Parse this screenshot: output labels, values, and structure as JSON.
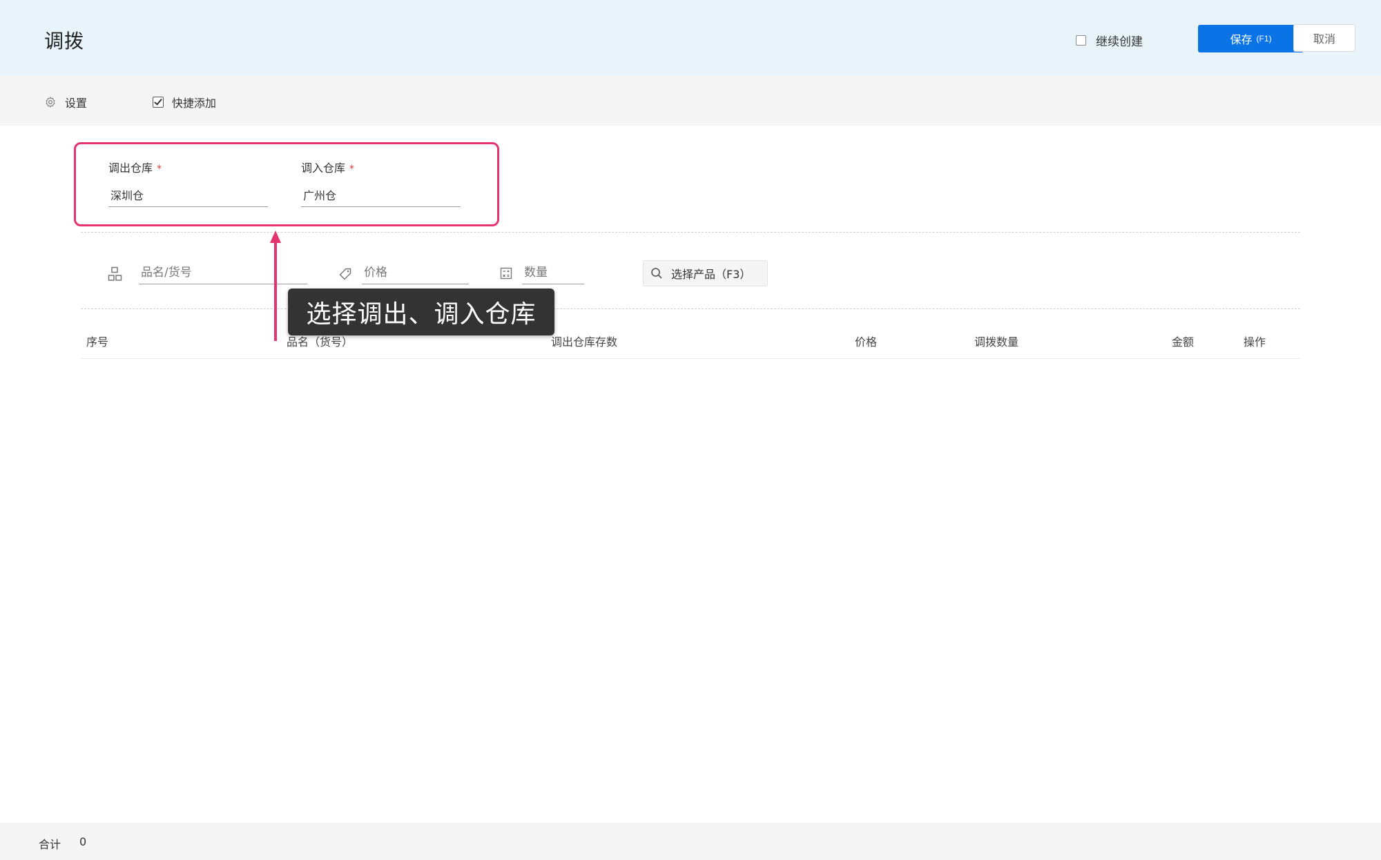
{
  "header": {
    "title": "调拨",
    "continue_create_label": "继续创建",
    "save_label": "保存",
    "save_shortcut": "(F1)",
    "cancel_label": "取消"
  },
  "toolbar": {
    "settings_label": "设置",
    "quick_add_label": "快捷添加"
  },
  "warehouse": {
    "out_label": "调出仓库",
    "out_value": "深圳仓",
    "in_label": "调入仓库",
    "in_value": "广州仓",
    "required_mark": "*"
  },
  "quick_add": {
    "name_placeholder": "品名/货号",
    "price_placeholder": "价格",
    "qty_placeholder": "数量",
    "select_product_label": "选择产品（F3）"
  },
  "table": {
    "columns": [
      "序号",
      "品名（货号）",
      "调出仓库存数",
      "价格",
      "调拨数量",
      "金额",
      "操作"
    ]
  },
  "annotation": {
    "text": "选择调出、调入仓库",
    "color": "#e5336f"
  },
  "footer": {
    "total_label": "合计",
    "total_value": "0"
  },
  "colors": {
    "primary": "#0a73e6",
    "header_bg": "#e8f4f9",
    "required": "#e53935"
  }
}
